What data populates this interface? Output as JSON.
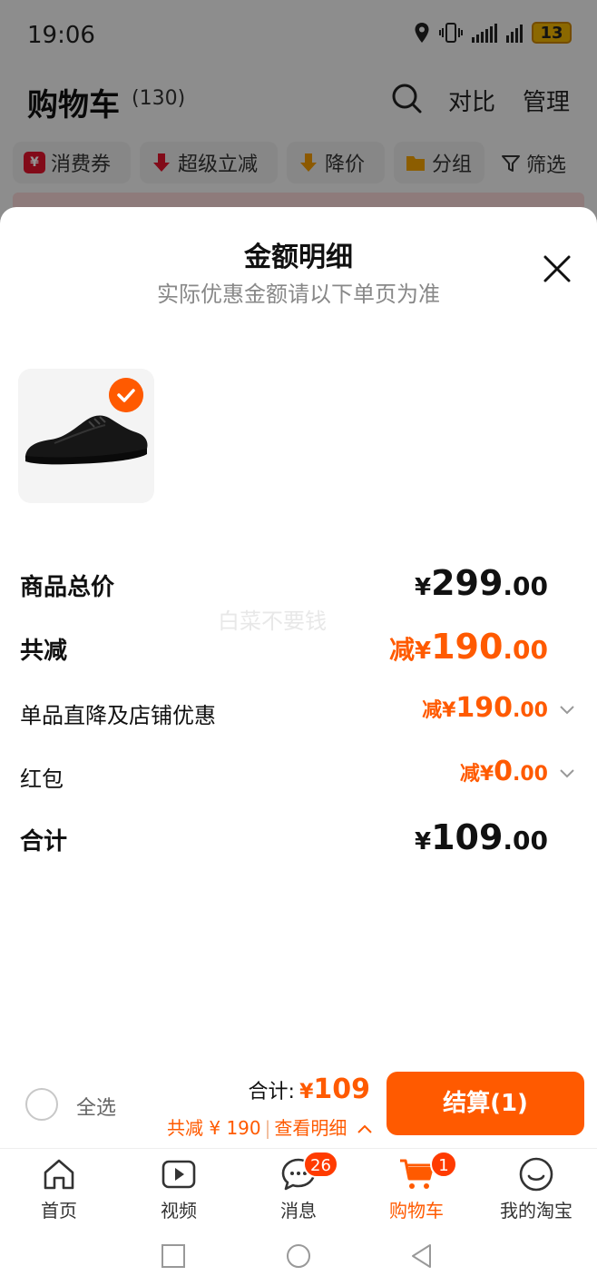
{
  "status_bar": {
    "time": "19:06",
    "battery": "13"
  },
  "cart_header": {
    "title": "购物车",
    "count": "(130)",
    "compare": "对比",
    "manage": "管理"
  },
  "filters": [
    {
      "label": "消费券",
      "icon": "coupon-icon"
    },
    {
      "label": "超级立减",
      "icon": "down-arrow-icon"
    },
    {
      "label": "降价",
      "icon": "price-drop-icon"
    },
    {
      "label": "分组",
      "icon": "folder-icon"
    }
  ],
  "filter_button": "筛选",
  "sheet": {
    "title": "金额明细",
    "subtitle": "实际优惠金额请以下单页为准",
    "watermark": "白菜不要钱",
    "rows": {
      "goods_total": {
        "label": "商品总价",
        "sym": "¥",
        "int": "299",
        "dec": ".00"
      },
      "total_discount": {
        "label": "共减",
        "prefix": "减",
        "sym": "¥",
        "int": "190",
        "dec": ".00"
      },
      "store_discount": {
        "label": "单品直降及店铺优惠",
        "prefix": "减",
        "sym": "¥",
        "int": "190",
        "dec": ".00"
      },
      "red_packet": {
        "label": "红包",
        "prefix": "减",
        "sym": "¥",
        "int": "0",
        "dec": ".00"
      },
      "grand_total": {
        "label": "合计",
        "sym": "¥",
        "int": "109",
        "dec": ".00"
      }
    }
  },
  "checkout_bar": {
    "select_all": "全选",
    "total_label": "合计:",
    "total_sym": "¥",
    "total_value": "109",
    "saving_text": "共减 ¥ 190",
    "separator": "|",
    "detail_link": "查看明细",
    "checkout_button": "结算(1)"
  },
  "tabbar": [
    {
      "label": "首页",
      "icon": "home-icon"
    },
    {
      "label": "视频",
      "icon": "video-icon"
    },
    {
      "label": "消息",
      "icon": "message-icon",
      "badge": "26"
    },
    {
      "label": "购物车",
      "icon": "cart-icon",
      "badge": "1",
      "active": true
    },
    {
      "label": "我的淘宝",
      "icon": "profile-icon"
    }
  ],
  "colors": {
    "accent": "#ff5a00",
    "badge": "#ff3b00"
  }
}
